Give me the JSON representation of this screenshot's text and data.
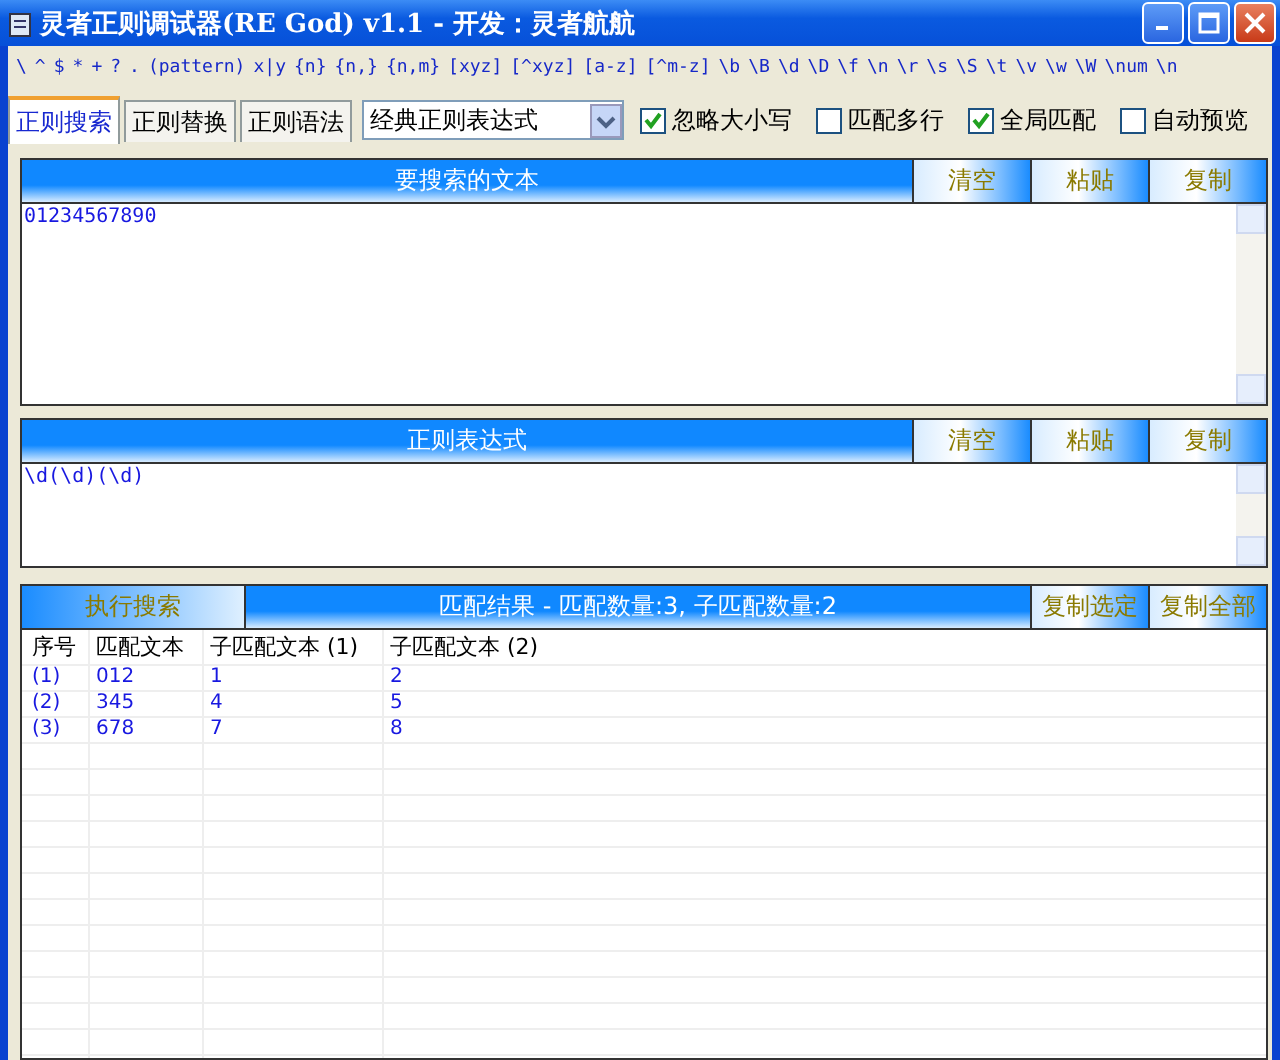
{
  "window": {
    "title": "灵者正则调试器(RE God) v1.1 - 开发：灵者航航"
  },
  "syntax_tokens": [
    "\\",
    "^",
    "$",
    "*",
    "+",
    "?",
    ".",
    "(pattern)",
    "x|y",
    "{n}",
    "{n,}",
    "{n,m}",
    "[xyz]",
    "[^xyz]",
    "[a-z]",
    "[^m-z]",
    "\\b",
    "\\B",
    "\\d",
    "\\D",
    "\\f",
    "\\n",
    "\\r",
    "\\s",
    "\\S",
    "\\t",
    "\\v",
    "\\w",
    "\\W",
    "\\num",
    "\\n"
  ],
  "tabs": [
    {
      "label": "正则搜索",
      "selected": true
    },
    {
      "label": "正则替换",
      "selected": false
    },
    {
      "label": "正则语法",
      "selected": false
    }
  ],
  "mode_dropdown": {
    "value": "经典正则表达式"
  },
  "options": [
    {
      "label": "忽略大小写",
      "checked": true
    },
    {
      "label": "匹配多行",
      "checked": false
    },
    {
      "label": "全局匹配",
      "checked": true
    },
    {
      "label": "自动预览",
      "checked": false
    }
  ],
  "search_panel": {
    "header": "要搜索的文本",
    "buttons": [
      "清空",
      "粘贴",
      "复制"
    ],
    "value": "01234567890"
  },
  "regex_panel": {
    "header": "正则表达式",
    "buttons": [
      "清空",
      "粘贴",
      "复制"
    ],
    "value": "\\d(\\d)(\\d)"
  },
  "results_panel": {
    "action_button": "执行搜索",
    "header": "匹配结果 - 匹配数量:3, 子匹配数量:2",
    "buttons": [
      "复制选定",
      "复制全部"
    ],
    "columns": [
      "序号",
      "匹配文本",
      "子匹配文本 (1)",
      "子匹配文本 (2)"
    ],
    "rows": [
      [
        "(1)",
        "012",
        "1",
        "2"
      ],
      [
        "(2)",
        "345",
        "4",
        "5"
      ],
      [
        "(3)",
        "678",
        "7",
        "8"
      ]
    ]
  }
}
